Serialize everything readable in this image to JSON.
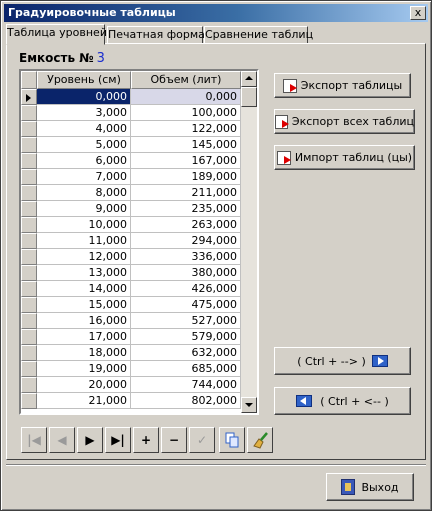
{
  "window": {
    "title": "Градуировочные таблицы",
    "close_label": "x"
  },
  "tabs": [
    {
      "label": "Таблица уровней",
      "active": true
    },
    {
      "label": "Печатная форма",
      "active": false
    },
    {
      "label": "Сравнение таблиц",
      "active": false
    }
  ],
  "tank": {
    "label": "Емкость №",
    "number": "3"
  },
  "table": {
    "columns": [
      "Уровень (см)",
      "Объем (лит)"
    ],
    "rows": [
      [
        "0,000",
        "0,000"
      ],
      [
        "3,000",
        "100,000"
      ],
      [
        "4,000",
        "122,000"
      ],
      [
        "5,000",
        "145,000"
      ],
      [
        "6,000",
        "167,000"
      ],
      [
        "7,000",
        "189,000"
      ],
      [
        "8,000",
        "211,000"
      ],
      [
        "9,000",
        "235,000"
      ],
      [
        "10,000",
        "263,000"
      ],
      [
        "11,000",
        "294,000"
      ],
      [
        "12,000",
        "336,000"
      ],
      [
        "13,000",
        "380,000"
      ],
      [
        "14,000",
        "426,000"
      ],
      [
        "15,000",
        "475,000"
      ],
      [
        "16,000",
        "527,000"
      ],
      [
        "17,000",
        "579,000"
      ],
      [
        "18,000",
        "632,000"
      ],
      [
        "19,000",
        "685,000"
      ],
      [
        "20,000",
        "744,000"
      ],
      [
        "21,000",
        "802,000"
      ]
    ]
  },
  "nav_buttons": [
    {
      "name": "first-record-button",
      "glyph": "|◀",
      "disabled": true
    },
    {
      "name": "prior-record-button",
      "glyph": "◀",
      "disabled": true
    },
    {
      "name": "next-record-button",
      "glyph": "▶",
      "disabled": false
    },
    {
      "name": "last-record-button",
      "glyph": "▶|",
      "disabled": false
    },
    {
      "name": "insert-record-button",
      "glyph": "+",
      "disabled": false
    },
    {
      "name": "delete-record-button",
      "glyph": "−",
      "disabled": false
    },
    {
      "name": "post-record-button",
      "glyph": "✓",
      "disabled": true
    }
  ],
  "actions": {
    "export_table": "Экспорт таблицы",
    "export_all": "Экспорт всех таблиц",
    "import_tables": "Импорт таблиц (цы)",
    "copy_right": "( Ctrl + --> )",
    "copy_left": "( Ctrl + <-- )",
    "exit": "Выход"
  },
  "icons": {
    "export_table": "export-doc-icon",
    "export_all": "export-all-doc-icon",
    "import_tables": "import-doc-icon",
    "copy_right": "arrow-right-icon",
    "copy_left": "arrow-left-icon",
    "exit": "exit-door-icon",
    "copy": "copy-icon",
    "clear": "broom-icon"
  },
  "colors": {
    "titlebar_start": "#0a246a",
    "selection": "#0a246a",
    "tank_number": "#1a2dcf"
  }
}
